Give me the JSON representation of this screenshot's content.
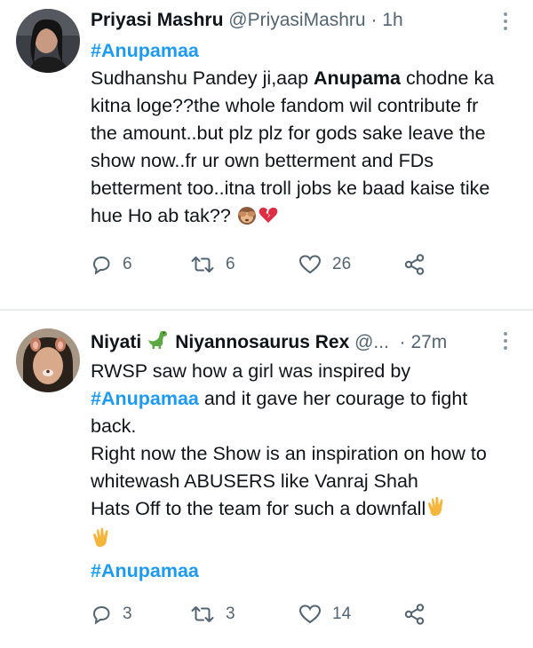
{
  "tweets": [
    {
      "name": "Priyasi Mashru",
      "handle": "@PriyasiMashru",
      "time": "1h",
      "hashtag": "#Anupamaa",
      "text_parts": {
        "p1": "Sudhanshu Pandey ji,aap ",
        "bold": "Anupama",
        "p2": " chodne ka kitna loge??the whole fandom wil contribute fr the amount..but plz plz for gods sake leave the show now..fr ur own betterment and FDs betterment too..itna troll jobs ke baad kaise tike hue Ho ab tak??"
      },
      "emojis": [
        "see-no-evil-monkey",
        "broken-heart"
      ],
      "replies": "6",
      "retweets": "6",
      "likes": "26"
    },
    {
      "name": "Niyati",
      "display_name_2": "Niyannosaurus Rex",
      "handle": "@...",
      "time": "27m",
      "lines": {
        "l1": "RWSP saw how a girl was inspired by",
        "hashtag_inline": "#Anupamaa",
        "l2": " and it gave her courage to fight back.",
        "l3": "Right now the Show is an inspiration on how to whitewash ABUSERS like Vanraj Shah",
        "l4": "Hats Off to the team for such a downfall"
      },
      "hashtag_end": "#Anupamaa",
      "emojis": [
        "dinosaur",
        "clapping-hands",
        "clapping-hands"
      ],
      "replies": "3",
      "retweets": "3",
      "likes": "14"
    }
  ],
  "colors": {
    "link": "#1d9bf0",
    "muted": "#536471",
    "divider": "#e6ecf0"
  }
}
